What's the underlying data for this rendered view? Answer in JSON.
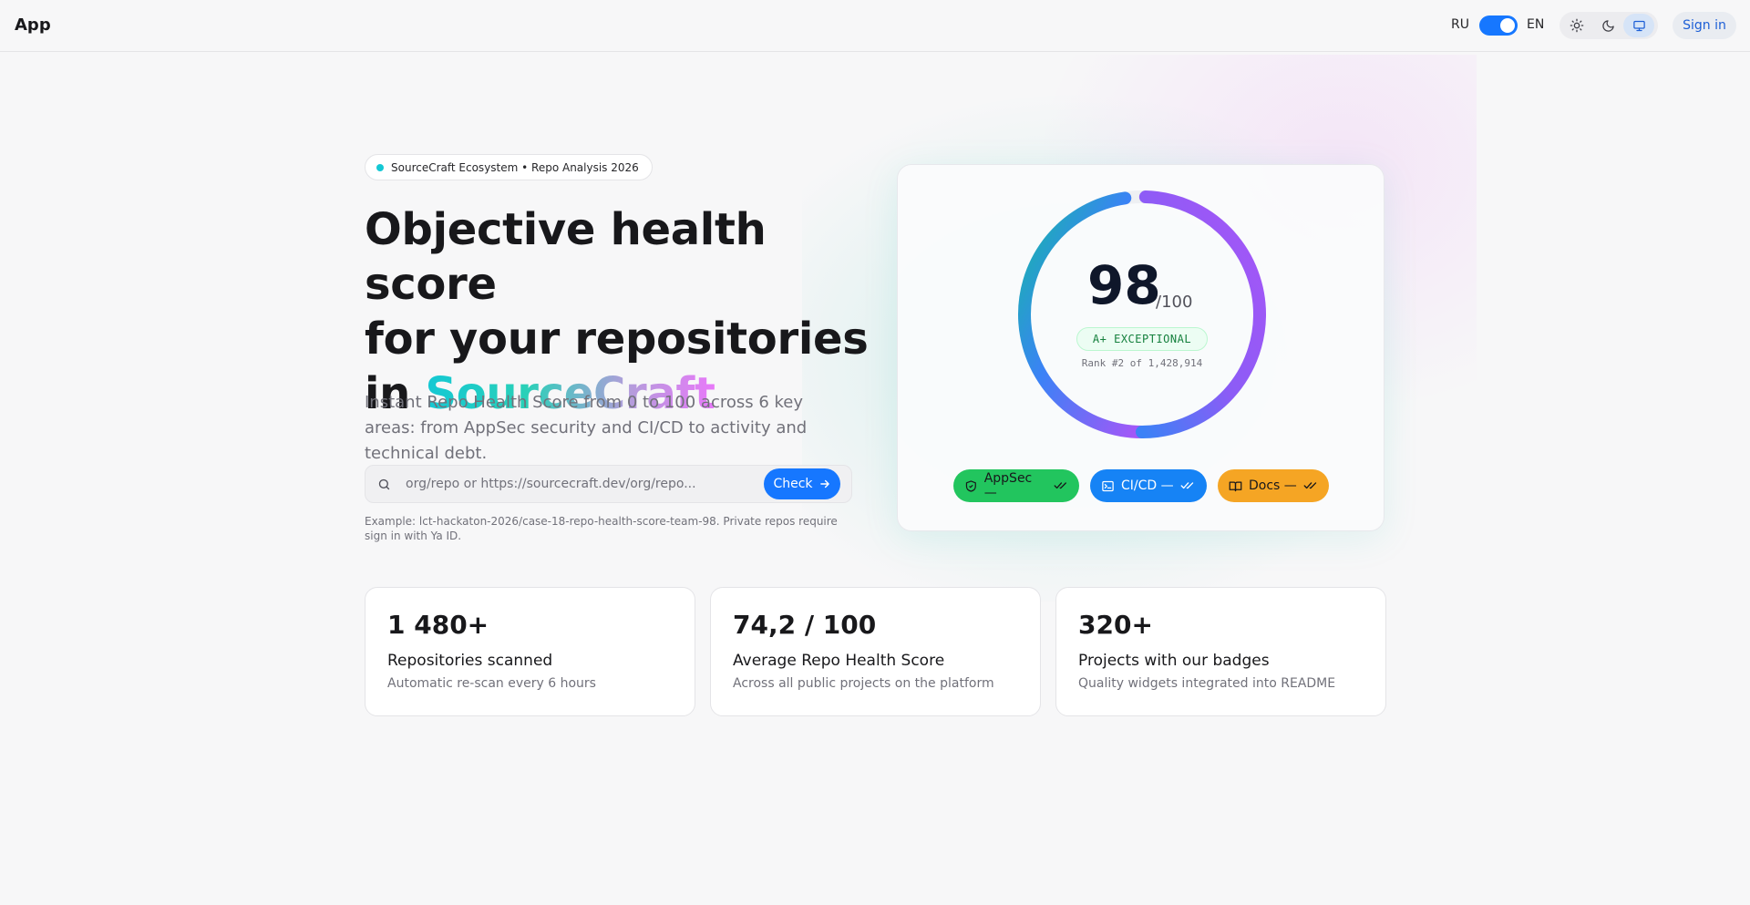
{
  "header": {
    "app_title": "App",
    "lang_left": "RU",
    "lang_right": "EN",
    "signin_label": "Sign in",
    "theme_options": [
      "light",
      "dark",
      "system"
    ],
    "active_theme": "system"
  },
  "hero": {
    "pill_text": "SourceCraft Ecosystem • Repo Analysis 2026",
    "headline_line1": "Objective health score",
    "headline_line2": "for your repositories",
    "headline_prefix3": "in ",
    "headline_brand": "SourceCraft",
    "subtext": "Instant Repo Health Score from 0 to 100 across 6 key areas: from AppSec security and CI/CD to activity and technical debt.",
    "search_placeholder": "org/repo or https://sourcecraft.dev/org/repo...",
    "search_value": "",
    "check_label": "Check",
    "example_text": "Example: lct-hackaton-2026/case-18-repo-health-score-team-98. Private repos require sign in with Ya ID."
  },
  "score_card": {
    "score": "98",
    "score_max": "/100",
    "score_fraction": 0.98,
    "grade": "A+ EXCEPTIONAL",
    "rank_text": "Rank #2 of 1,428,914",
    "chips": [
      {
        "label": "AppSec —",
        "icon": "shield-icon",
        "color": "#22c55e"
      },
      {
        "label": "CI/CD —",
        "icon": "terminal-icon",
        "color": "#1683f5"
      },
      {
        "label": "Docs —",
        "icon": "book-icon",
        "color": "#f5a524"
      }
    ]
  },
  "stats": [
    {
      "value": "1 480+",
      "label": "Repositories scanned",
      "desc": "Automatic re-scan every 6 hours"
    },
    {
      "value": "74,2 / 100",
      "label": "Average Repo Health Score",
      "desc": "Across all public projects on the platform"
    },
    {
      "value": "320+",
      "label": "Projects with our badges",
      "desc": "Quality widgets integrated into README"
    }
  ],
  "colors": {
    "accent": "#1677ff",
    "brand_gradient": [
      "#14c8d4",
      "#2ad0b8",
      "#b39ddb",
      "#e879f9"
    ],
    "ring_gradient": [
      "#14b8a6",
      "#3b82f6",
      "#8b5cf6",
      "#a855f7"
    ]
  }
}
